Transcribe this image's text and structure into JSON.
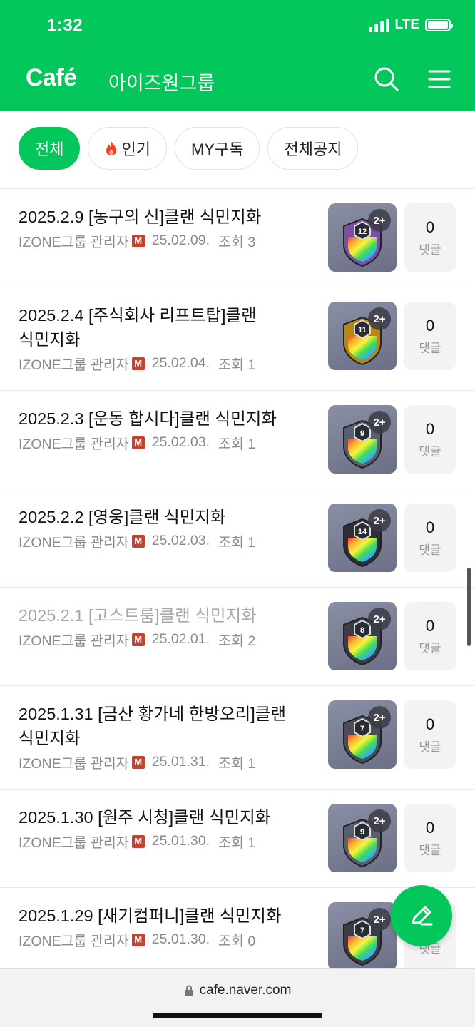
{
  "status_bar": {
    "time": "1:32",
    "network": "LTE"
  },
  "header": {
    "logo": "Café",
    "cafe_name": "아이즈원그룹",
    "search_icon": "search-icon",
    "menu_icon": "hamburger-menu-icon"
  },
  "tabs": [
    {
      "label": "전체",
      "active": true
    },
    {
      "label": "인기",
      "icon": "fire-icon",
      "active": false
    },
    {
      "label": "MY구독",
      "active": false
    },
    {
      "label": "전체공지",
      "active": false
    }
  ],
  "posts": [
    {
      "title": "2025.2.9 [농구의 신]클랜 식민지화",
      "author": "IZONE그룹 관리자",
      "badge": "M",
      "date": "25.02.09.",
      "views": "조회 3",
      "image_count": "2+",
      "badge_level": "12",
      "comments": "0",
      "comments_label": "댓글",
      "read": false
    },
    {
      "title": "2025.2.4 [주식회사 리프트탑]클랜 식민지화",
      "author": "IZONE그룹 관리자",
      "badge": "M",
      "date": "25.02.04.",
      "views": "조회 1",
      "image_count": "2+",
      "badge_level": "11",
      "comments": "0",
      "comments_label": "댓글",
      "read": false
    },
    {
      "title": "2025.2.3 [운동 합시다]클랜 식민지화",
      "author": "IZONE그룹 관리자",
      "badge": "M",
      "date": "25.02.03.",
      "views": "조회 1",
      "image_count": "2+",
      "badge_level": "9",
      "comments": "0",
      "comments_label": "댓글",
      "read": false
    },
    {
      "title": "2025.2.2 [영웅]클랜 식민지화",
      "author": "IZONE그룹 관리자",
      "badge": "M",
      "date": "25.02.03.",
      "views": "조회 1",
      "image_count": "2+",
      "badge_level": "14",
      "comments": "0",
      "comments_label": "댓글",
      "read": false
    },
    {
      "title": "2025.2.1 [고스트룸]클랜 식민지화",
      "author": "IZONE그룹 관리자",
      "badge": "M",
      "date": "25.02.01.",
      "views": "조회 2",
      "image_count": "2+",
      "badge_level": "8",
      "comments": "0",
      "comments_label": "댓글",
      "read": true
    },
    {
      "title": "2025.1.31 [금산 황가네 한방오리]클랜 식민지화",
      "author": "IZONE그룹 관리자",
      "badge": "M",
      "date": "25.01.31.",
      "views": "조회 1",
      "image_count": "2+",
      "badge_level": "7",
      "comments": "0",
      "comments_label": "댓글",
      "read": false
    },
    {
      "title": "2025.1.30 [원주 시청]클랜 식민지화",
      "author": "IZONE그룹 관리자",
      "badge": "M",
      "date": "25.01.30.",
      "views": "조회 1",
      "image_count": "2+",
      "badge_level": "9",
      "comments": "0",
      "comments_label": "댓글",
      "read": false
    },
    {
      "title": "2025.1.29 [새기컴퍼니]클랜 식민지화",
      "author": "IZONE그룹 관리자",
      "badge": "M",
      "date": "25.01.30.",
      "views": "조회 0",
      "image_count": "2+",
      "badge_level": "7",
      "comments": "0",
      "comments_label": "댓글",
      "read": false
    }
  ],
  "fab": {
    "icon": "pencil-icon"
  },
  "browser": {
    "url": "cafe.naver.com",
    "lock_icon": "lock-icon"
  },
  "colors": {
    "brand": "#03c75a",
    "manager_badge": "#c8402e"
  }
}
